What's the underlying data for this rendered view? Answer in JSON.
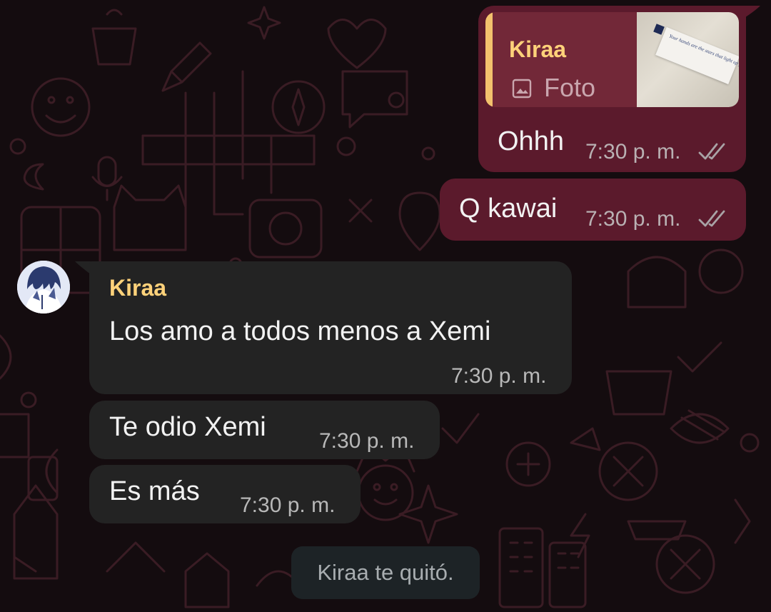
{
  "colors": {
    "background": "#140c0f",
    "outgoing_bubble": "#5b1a2c",
    "incoming_bubble": "#232323",
    "quote_background": "#722838",
    "quote_bar": "#f3c16d",
    "sender_name": "#ffd27a",
    "read_ticks": "#a9a3a6"
  },
  "messages": {
    "reply_message": {
      "quote": {
        "author": "Kiraa",
        "type_label": "Foto",
        "icon": "image-icon",
        "thumbnail_text": "Your hands are the stars that light up your life."
      },
      "text": "Ohhh",
      "time": "7:30 p. m.",
      "status_icon": "double-check-icon"
    },
    "kawai_message": {
      "text": "Q kawai",
      "time": "7:30 p. m.",
      "status_icon": "double-check-icon"
    },
    "incoming_1": {
      "sender": "Kiraa",
      "text": "Los amo a todos menos a Xemi",
      "time": "7:30 p. m."
    },
    "incoming_2": {
      "text": "Te odio Xemi",
      "time": "7:30 p. m."
    },
    "incoming_3": {
      "text": "Es más",
      "time": "7:30 p. m."
    }
  },
  "system_message": {
    "text": "Kiraa te quitó."
  }
}
